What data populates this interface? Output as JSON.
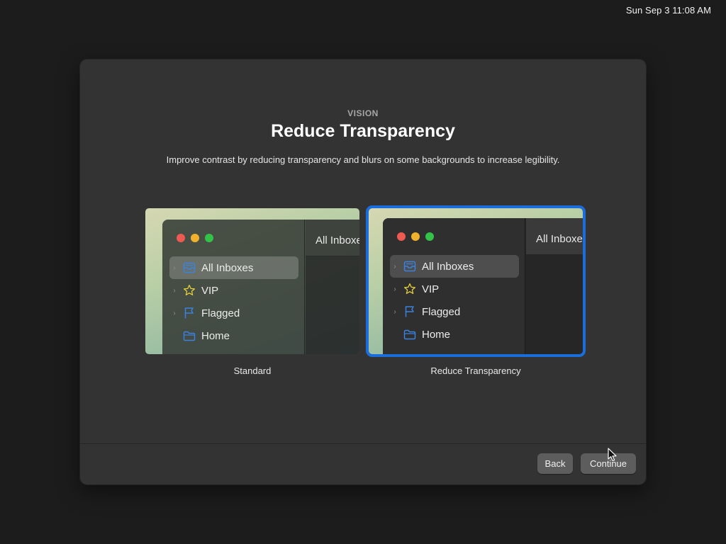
{
  "menubar": {
    "clock": "Sun Sep 3  11:08 AM"
  },
  "dialog": {
    "eyebrow": "VISION",
    "title": "Reduce Transparency",
    "description": "Improve contrast by reducing transparency and blurs on some backgrounds to increase legibility.",
    "options": [
      {
        "label": "Standard",
        "selected": false,
        "preview": {
          "header": "All Inboxes",
          "items": [
            {
              "label": "All Inboxes",
              "icon": "inbox-stack-icon",
              "selected": true
            },
            {
              "label": "VIP",
              "icon": "star-icon",
              "selected": false
            },
            {
              "label": "Flagged",
              "icon": "flag-icon",
              "selected": false
            },
            {
              "label": "Home",
              "icon": "folder-icon",
              "selected": false
            }
          ]
        }
      },
      {
        "label": "Reduce Transparency",
        "selected": true,
        "preview": {
          "header": "All Inboxes",
          "items": [
            {
              "label": "All Inboxes",
              "icon": "inbox-stack-icon",
              "selected": true
            },
            {
              "label": "VIP",
              "icon": "star-icon",
              "selected": false
            },
            {
              "label": "Flagged",
              "icon": "flag-icon",
              "selected": false
            },
            {
              "label": "Home",
              "icon": "folder-icon",
              "selected": false
            }
          ]
        }
      }
    ],
    "buttons": {
      "back": "Back",
      "continue": "Continue"
    }
  },
  "colors": {
    "selection_ring": "#1a6ddb",
    "window_bg": "#333334",
    "desktop_bg": "#1c1c1d",
    "icon_blue": "#3b82e0",
    "icon_yellow": "#e8d33a"
  }
}
